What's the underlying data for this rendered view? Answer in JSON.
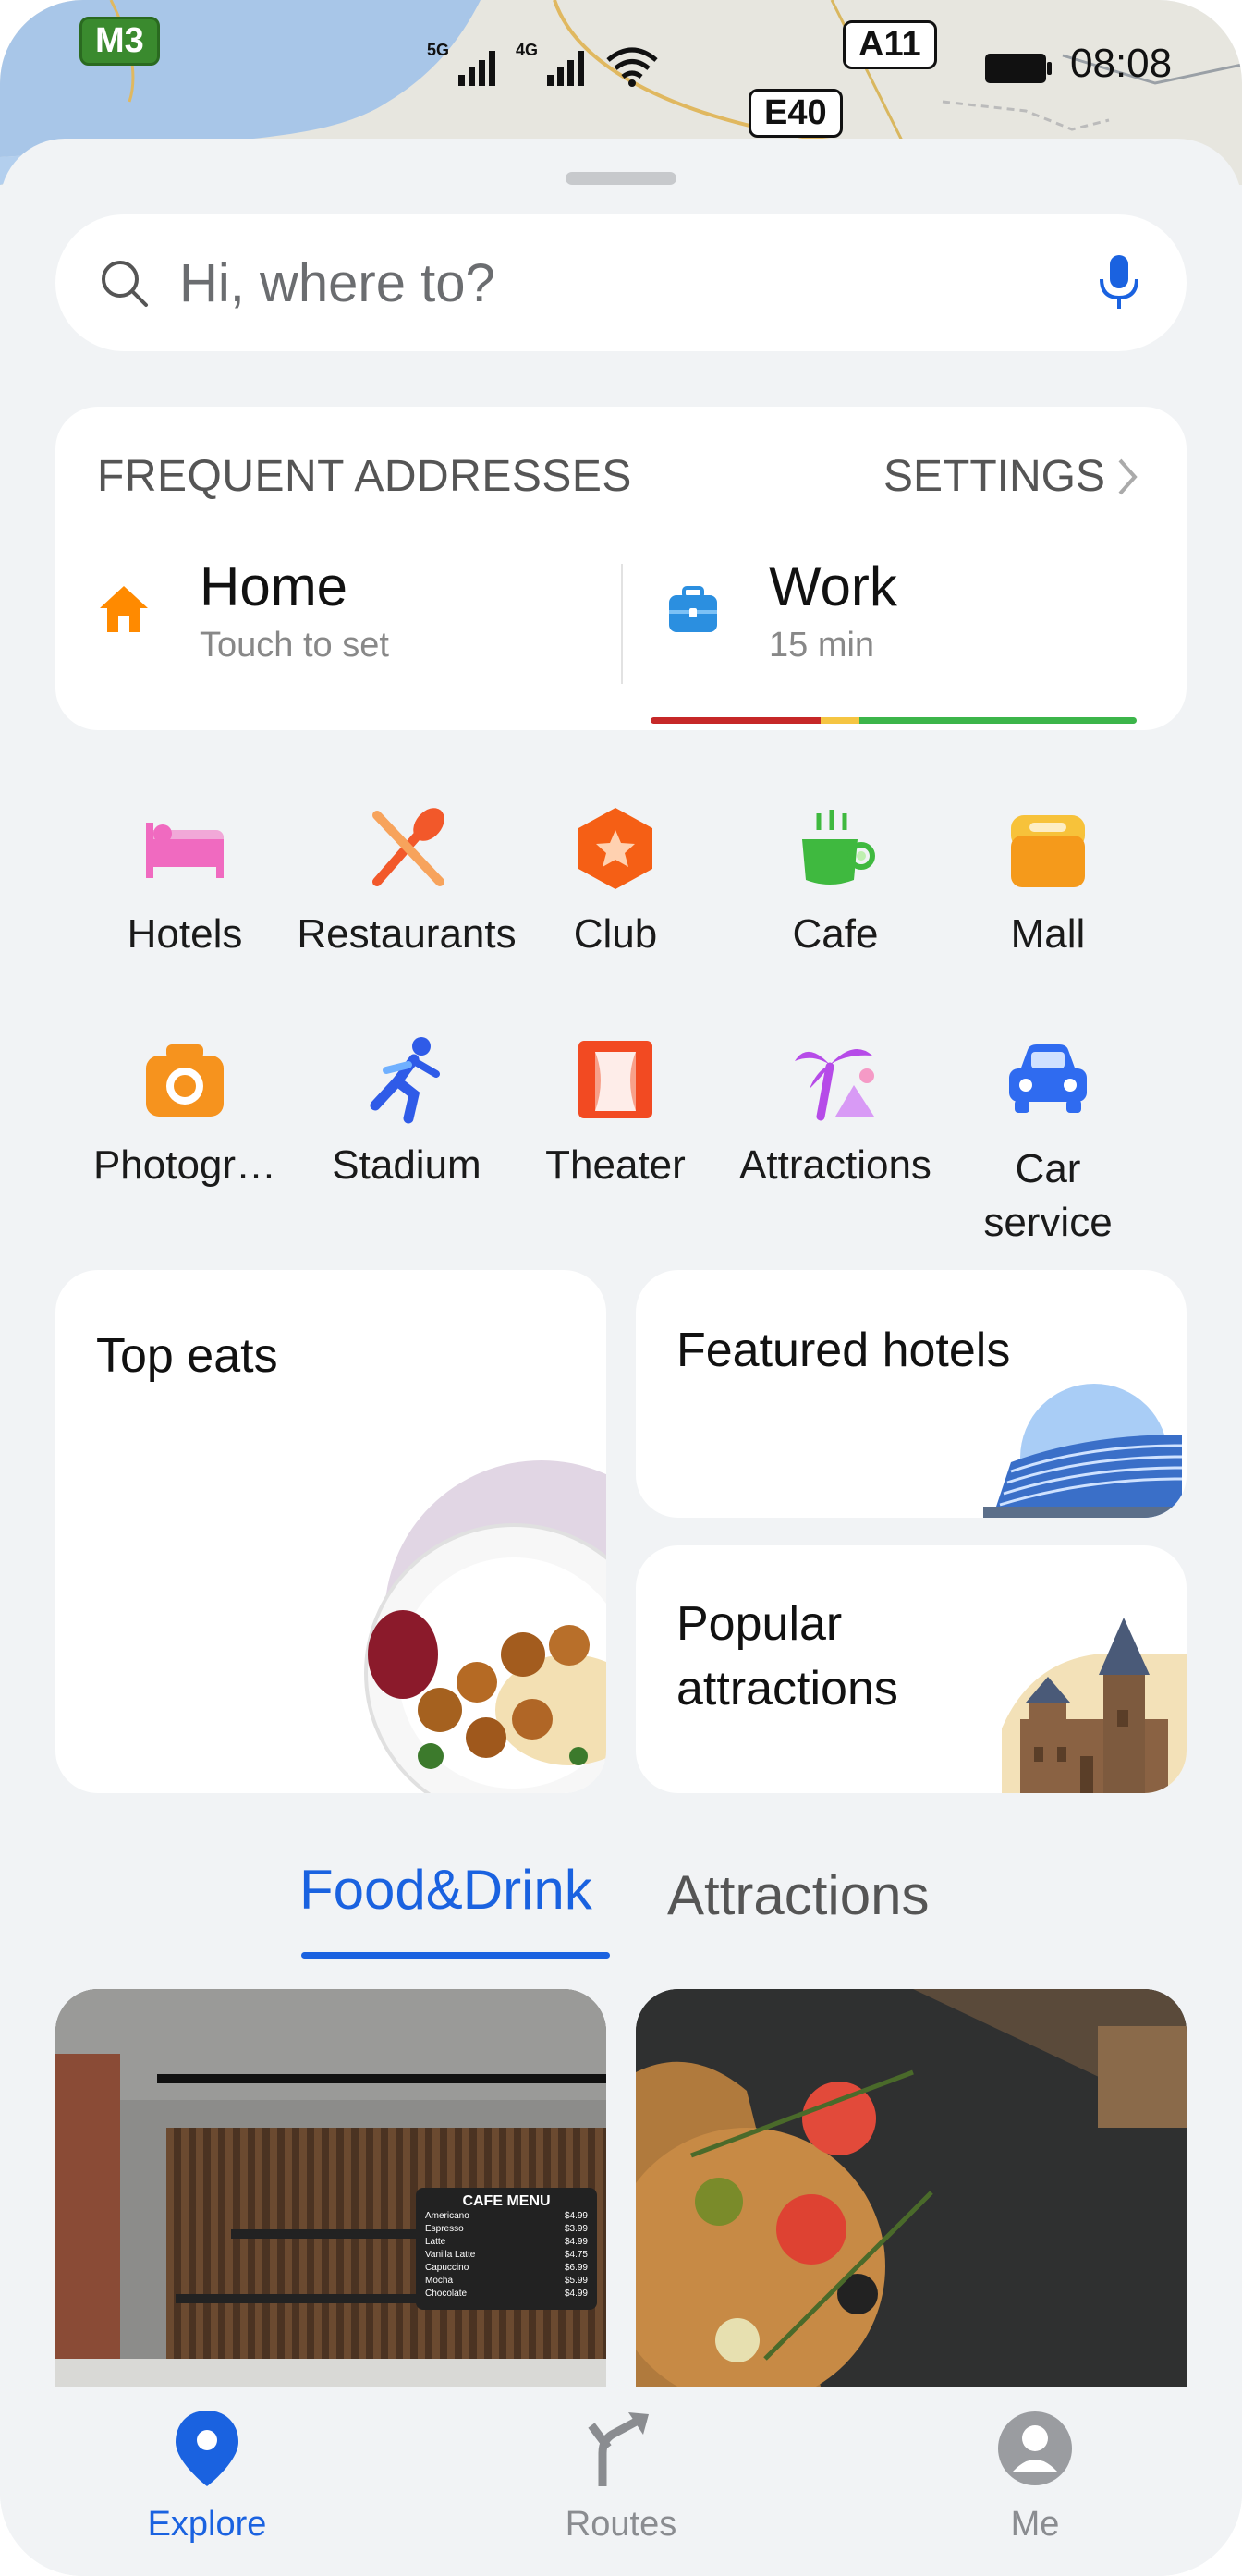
{
  "status_bar": {
    "signal1_label": "5G",
    "signal2_label": "4G",
    "time": "08:08"
  },
  "map": {
    "road_m3": "M3",
    "road_a11": "A11",
    "road_e40": "E40"
  },
  "search": {
    "placeholder": "Hi, where to?",
    "mic_icon": "microphone-icon"
  },
  "frequent": {
    "title": "FREQUENT ADDRESSES",
    "settings_label": "SETTINGS",
    "home": {
      "name": "Home",
      "sub": "Touch to set",
      "icon": "home-icon",
      "color": "#ff8a00"
    },
    "work": {
      "name": "Work",
      "sub": "15 min",
      "icon": "briefcase-icon",
      "color": "#2b8fe0",
      "traffic": [
        {
          "color": "#c62828",
          "share": 0.35
        },
        {
          "color": "#f5c542",
          "share": 0.08
        },
        {
          "color": "#3cb54a",
          "share": 0.57
        }
      ]
    }
  },
  "categories": [
    {
      "label": "Hotels",
      "icon": "bed-icon",
      "color": "#f06ac0"
    },
    {
      "label": "Restaurants",
      "icon": "utensils-icon",
      "color": "#f2582a"
    },
    {
      "label": "Club",
      "icon": "star-hexagon-icon",
      "color": "#f55f15"
    },
    {
      "label": "Cafe",
      "icon": "coffee-cup-icon",
      "color": "#3fb93f"
    },
    {
      "label": "Mall",
      "icon": "shopping-bag-icon",
      "color": "#f59a1b"
    },
    {
      "label": "Photogr…",
      "icon": "camera-icon",
      "color": "#f6931e"
    },
    {
      "label": "Stadium",
      "icon": "runner-icon",
      "color": "#2f5be8"
    },
    {
      "label": "Theater",
      "icon": "theater-curtain-icon",
      "color": "#f24a22"
    },
    {
      "label": "Attractions",
      "icon": "palm-tree-icon",
      "color": "#b64be8"
    },
    {
      "label": "Car service",
      "icon": "car-icon",
      "color": "#2f6bf0"
    }
  ],
  "tiles": {
    "top_eats": "Top eats",
    "featured_hotels": "Featured hotels",
    "popular_attractions_line1": "Popular",
    "popular_attractions_line2": "attractions"
  },
  "tabs": [
    {
      "label": "Food&Drink",
      "active": true
    },
    {
      "label": "Attractions",
      "active": false
    }
  ],
  "cafe_menu": {
    "title": "CAFE  MENU",
    "items": [
      {
        "name": "Americano",
        "price": "$4.99"
      },
      {
        "name": "Espresso",
        "price": "$3.99"
      },
      {
        "name": "Latte",
        "price": "$4.99"
      },
      {
        "name": "Vanilla Latte",
        "price": "$4.75"
      },
      {
        "name": "Capuccino",
        "price": "$6.99"
      },
      {
        "name": "Mocha",
        "price": "$5.99"
      },
      {
        "name": "Chocolate",
        "price": "$4.99"
      }
    ]
  },
  "bottom_nav": [
    {
      "label": "Explore",
      "icon": "location-pin-icon",
      "active": true
    },
    {
      "label": "Routes",
      "icon": "fork-arrow-icon",
      "active": false
    },
    {
      "label": "Me",
      "icon": "avatar-icon",
      "active": false
    }
  ],
  "colors": {
    "accent": "#1a62e0",
    "inactive": "#8a8c90"
  }
}
